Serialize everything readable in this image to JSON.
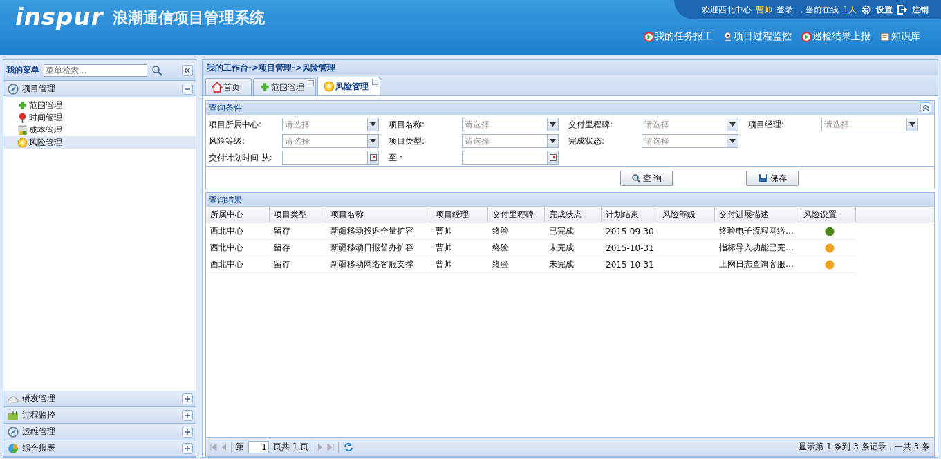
{
  "header": {
    "logo": "inspur",
    "title": "浪潮通信项目管理系统",
    "welcome": "欢迎西北中心",
    "user": "曹帅",
    "login_text": "登录",
    "online_label": "，当前在线",
    "online_count": "1人",
    "settings": "设置",
    "logout": "注销",
    "links": [
      {
        "label": "我的任务报工",
        "kind": "play"
      },
      {
        "label": "项目过程监控",
        "kind": "monitor"
      },
      {
        "label": "巡检结果上报",
        "kind": "play"
      },
      {
        "label": "知识库",
        "kind": "book"
      }
    ]
  },
  "sidebar": {
    "title": "我的菜单",
    "search": {
      "placeholder": "菜单检索..."
    },
    "groups": [
      {
        "label": "项目管理",
        "kind": "compass",
        "expanded": true,
        "children": [
          {
            "label": "范围管理",
            "kind": "plus",
            "selected": false
          },
          {
            "label": "时间管理",
            "kind": "pin",
            "selected": false
          },
          {
            "label": "成本管理",
            "kind": "money",
            "selected": false
          },
          {
            "label": "风险管理",
            "kind": "coin",
            "selected": true
          }
        ]
      },
      {
        "label": "研发管理",
        "kind": "envelope",
        "expanded": false
      },
      {
        "label": "过程监控",
        "kind": "calendar",
        "expanded": false
      },
      {
        "label": "运维管理",
        "kind": "compass",
        "expanded": false
      },
      {
        "label": "综合报表",
        "kind": "pie",
        "expanded": false
      }
    ]
  },
  "breadcrumb": "我的工作台->项目管理->风险管理",
  "tabs": [
    {
      "label": "首页",
      "kind": "home",
      "selected": false,
      "closable": false
    },
    {
      "label": "范围管理",
      "kind": "plus",
      "selected": false,
      "closable": true
    },
    {
      "label": "风险管理",
      "kind": "coin",
      "selected": true,
      "closable": true
    }
  ],
  "query": {
    "title": "查询条件",
    "rows": [
      [
        {
          "label": "项目所属中心:",
          "kind": "select",
          "placeholder": "请选择"
        },
        {
          "label": "项目名称:",
          "kind": "select",
          "placeholder": "请选择"
        },
        {
          "label": "交付里程碑:",
          "kind": "select",
          "placeholder": "请选择"
        },
        {
          "label": "项目经理:",
          "kind": "select",
          "placeholder": "请选择"
        }
      ],
      [
        {
          "label": "风险等级:",
          "kind": "select",
          "placeholder": "请选择"
        },
        {
          "label": "项目类型:",
          "kind": "select",
          "placeholder": "请选择"
        },
        {
          "label": "完成状态:",
          "kind": "select",
          "placeholder": "请选择"
        }
      ],
      [
        {
          "label": "交付计划时间 从:",
          "kind": "date"
        },
        {
          "label": "至：",
          "kind": "date"
        }
      ]
    ],
    "buttons": [
      {
        "label": "查 询",
        "kind": "search"
      },
      {
        "label": "保存",
        "kind": "save"
      }
    ]
  },
  "results": {
    "title": "查询结果",
    "columns": [
      "所属中心",
      "项目类型",
      "项目名称",
      "项目经理",
      "交付里程碑",
      "完成状态",
      "计划结束",
      "风险等级",
      "交付进展描述",
      "风险设置"
    ],
    "rows": [
      {
        "cells": [
          "西北中心",
          "留存",
          "新疆移动投诉全量扩容",
          "曹帅",
          "终验",
          "已完成",
          "2015-09-30",
          "",
          "终验电子流程网络…"
        ],
        "color": "#4f8a1c"
      },
      {
        "cells": [
          "西北中心",
          "留存",
          "新疆移动日报督办扩容",
          "曹帅",
          "终验",
          "未完成",
          "2015-10-31",
          "",
          "指标导入功能已完…"
        ],
        "color": "#f0a020"
      },
      {
        "cells": [
          "西北中心",
          "留存",
          "新疆移动网络客服支撑",
          "曹帅",
          "终验",
          "未完成",
          "2015-10-31",
          "",
          "上网日志查询客服…"
        ],
        "color": "#f0a020"
      }
    ]
  },
  "pager": {
    "prefix": "第",
    "page": "1",
    "suffix": "页共 1 页",
    "summary": "显示第 1 条到 3 条记录，一共 3 条"
  }
}
